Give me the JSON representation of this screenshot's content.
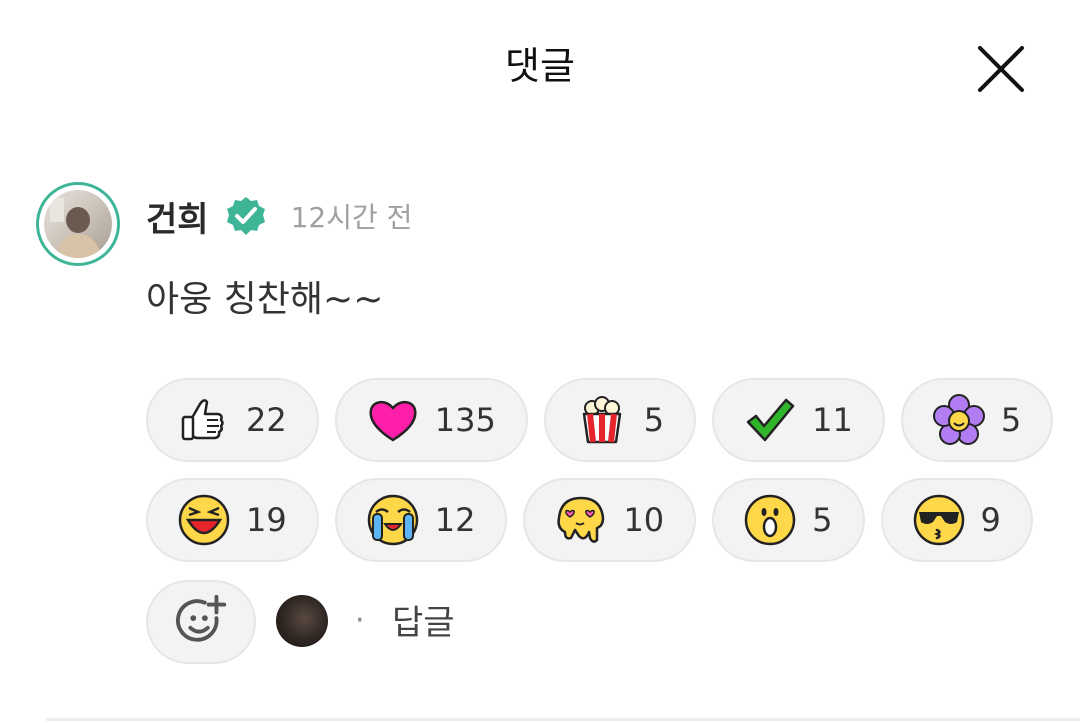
{
  "header": {
    "title": "댓글"
  },
  "comment": {
    "author": "건희",
    "time": "12시간 전",
    "text": "아웅 칭찬해~~"
  },
  "reactions": [
    {
      "icon": "thumbs-up-icon",
      "count": "22"
    },
    {
      "icon": "heart-icon",
      "count": "135"
    },
    {
      "icon": "popcorn-icon",
      "count": "5"
    },
    {
      "icon": "check-icon",
      "count": "11"
    },
    {
      "icon": "flower-icon",
      "count": "5"
    },
    {
      "icon": "laughing-face-icon",
      "count": "19"
    },
    {
      "icon": "crying-face-icon",
      "count": "12"
    },
    {
      "icon": "melting-face-icon",
      "count": "10"
    },
    {
      "icon": "surprised-face-icon",
      "count": "5"
    },
    {
      "icon": "sunglasses-kiss-face-icon",
      "count": "9"
    }
  ],
  "actions": {
    "reply_label": "답글",
    "separator": "·"
  },
  "colors": {
    "accent": "#3fb597",
    "pill_bg": "#f3f3f3",
    "heart": "#ff1fa8",
    "emoji_yellow": "#ffd84a"
  }
}
